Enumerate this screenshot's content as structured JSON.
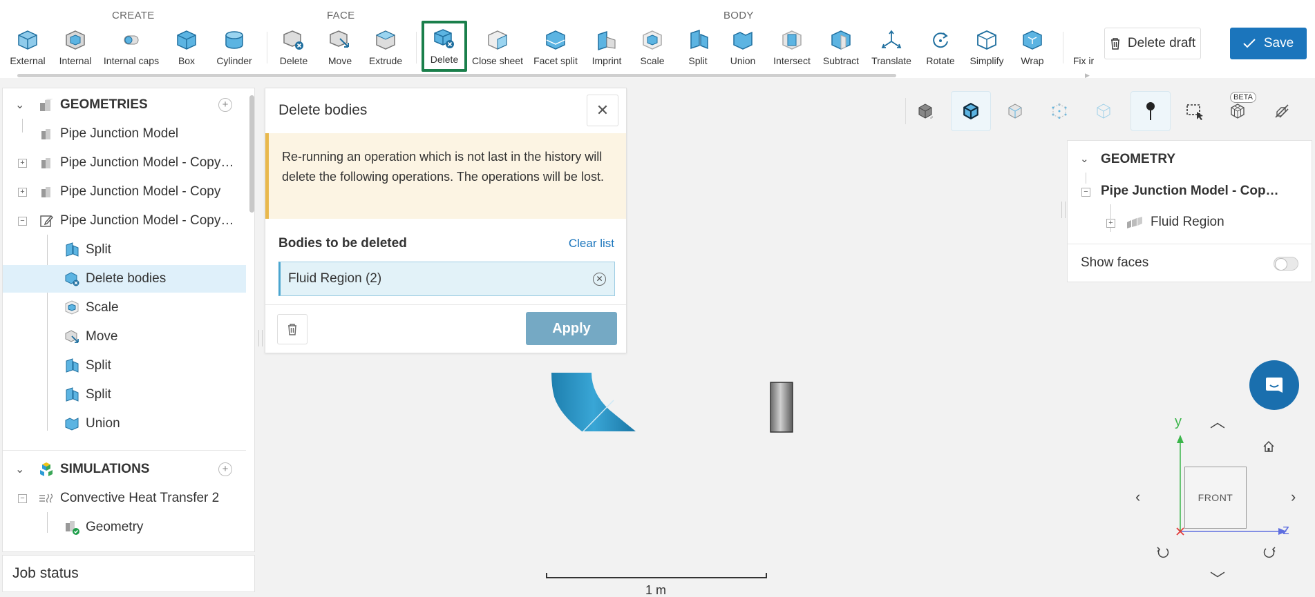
{
  "toolbar": {
    "groups": {
      "create": "CREATE",
      "face": "FACE",
      "body": "BODY"
    },
    "tools": {
      "external": "External",
      "internal": "Internal",
      "internal_caps": "Internal caps",
      "box": "Box",
      "cylinder": "Cylinder",
      "face_delete": "Delete",
      "face_move": "Move",
      "face_extrude": "Extrude",
      "body_delete": "Delete",
      "close_sheet": "Close sheet",
      "facet_split": "Facet split",
      "imprint": "Imprint",
      "scale": "Scale",
      "split": "Split",
      "union": "Union",
      "intersect": "Intersect",
      "subtract": "Subtract",
      "translate": "Translate",
      "rotate": "Rotate",
      "simplify": "Simplify",
      "wrap": "Wrap",
      "fix": "Fix ir"
    },
    "delete_draft": "Delete draft",
    "save": "Save"
  },
  "left_panel": {
    "geometries_title": "GEOMETRIES",
    "geometries": [
      "Pipe Junction Model",
      "Pipe Junction Model - Copy…",
      "Pipe Junction Model - Copy",
      "Pipe Junction Model - Copy…"
    ],
    "operations": [
      "Split",
      "Delete bodies",
      "Scale",
      "Move",
      "Split",
      "Split",
      "Union"
    ],
    "simulations_title": "SIMULATIONS",
    "simulation": "Convective Heat Transfer 2",
    "sim_child": "Geometry",
    "job_status": "Job status"
  },
  "dialog": {
    "title": "Delete bodies",
    "warning": "Re-running an operation which is not last in the history will delete the following operations. The operations will be lost.",
    "bodies_label": "Bodies to be deleted",
    "clear_list": "Clear list",
    "body_item": "Fluid Region (2)",
    "apply": "Apply"
  },
  "viewer": {
    "beta": "BETA",
    "geometry_panel": {
      "title": "GEOMETRY",
      "model": "Pipe Junction Model - Cop…",
      "child": "Fluid Region",
      "show_faces": "Show faces",
      "show_faces_on": false
    },
    "scale_label": "1 m",
    "nav_cube_face": "FRONT",
    "axes": {
      "y": "y",
      "z": "z"
    }
  },
  "colors": {
    "accent": "#1b75bc",
    "active_tool_border": "#1a7f4b",
    "icon_blue": "#2e9bd6",
    "warning_bg": "#fcf4e3",
    "apply_disabled": "#75a9c4"
  }
}
